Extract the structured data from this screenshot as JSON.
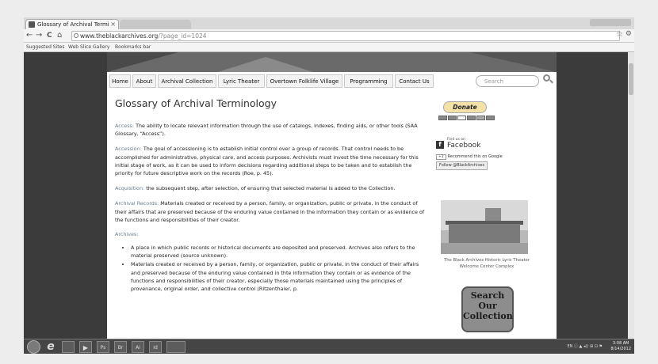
{
  "browser": {
    "tab_title": "Glossary of Archival Termi",
    "tab_close": "×",
    "back": "←",
    "forward": "→",
    "reload": "C",
    "home": "⌂",
    "url_host": "www.theblackarchives.org",
    "url_path": "/?page_id=1024",
    "star": "☆",
    "wrench": "⚙",
    "bookmarks": [
      "Suggested Sites",
      "Web Slice Gallery",
      "Bookmarks bar"
    ]
  },
  "site": {
    "nav": [
      "Home",
      "About",
      "Archival Collection",
      "Lyric Theater",
      "Overtown Folklife Village",
      "Programming",
      "Contact Us"
    ],
    "search_placeholder": "Search"
  },
  "page": {
    "title": "Glossary of Archival Terminology",
    "entries": [
      {
        "term": "Access:",
        "text": " The ability to locate relevant information through the use of catalogs, indexes, finding aids, or other tools (SAA Glossary, “Access”)."
      },
      {
        "term": "Accession:",
        "text": " The goal of accessioning is to establish initial control over a group of records.  That control needs to be accomplished for administrative, physical care, and access purposes.  Archivists must invest the time necessary for this initial stage of work, as it can be used to inform decisions regarding additional steps to be taken and to establish the priority for future descriptive work on the records (Roe, p. 45)."
      },
      {
        "term": "Acquisition:",
        "text": " the subsequent step, after selection, of ensuring that selected material is added to the Collection."
      },
      {
        "term": "Archival Records:",
        "text": " Materials created or received by a person, family, or organization, public or private, in the conduct of their affairs that are preserved because of the enduring value contained in the information they contain or as evidence of the functions and responsibilities of their creator."
      }
    ],
    "archives_heading": "Archives:",
    "archives_defs": [
      "A place in which public records or historical documents are deposited and preserved. Archives also refers to the material preserved (source unknown).",
      "Materials created or received by a person, family, or organization, public or private, in the conduct of their affairs and preserved because of the enduring value contained in thte information they contain or as evidence of the functions and responsibilities of their creator, especially those materials maintained using the principles of provenance, original order, and collective control (Ritzenthaler, p."
    ]
  },
  "sidebar": {
    "donate": "Donate",
    "card_brands": [
      "mastercard-icon",
      "amex-icon",
      "visa-icon",
      "discover-icon",
      "bank-icon",
      "echeck-icon"
    ],
    "fb_find": "Find us on",
    "fb_name": "Facebook",
    "fb_letter": "f",
    "gplus_count": "+1",
    "gplus_text": "Recommend this on Google",
    "twitter": "Follow @BlackArchives",
    "caption": "The Black Archives Historic Lyric Theater Welcome Center Complex",
    "search_collection": "Search\nOur\nCollection"
  },
  "taskbar": {
    "ie_glyph": "e",
    "apps": [
      "Ps",
      "Br",
      "Ai"
    ],
    "tray": "EN ⓘ ▲ ◂)) ⊞ ⊡ ⚑",
    "time": "3:08 AM",
    "date": "8/14/2012"
  }
}
